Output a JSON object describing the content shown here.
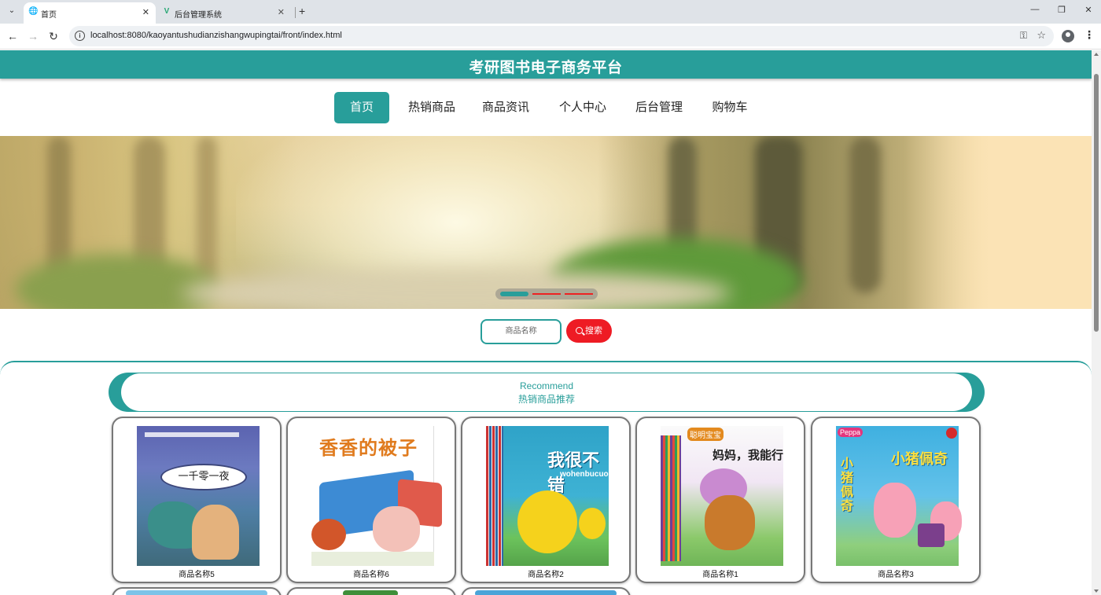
{
  "browser": {
    "tabs": [
      {
        "title": "首页",
        "active": true,
        "icon": "globe-icon"
      },
      {
        "title": "后台管理系统",
        "active": false,
        "icon": "vue-logo-icon"
      }
    ],
    "url": "localhost:8080/kaoyantushudianzishangwupingtai/front/index.html"
  },
  "site": {
    "title": "考研图书电子商务平台",
    "accent_color": "#289e9a"
  },
  "nav": {
    "items": [
      {
        "label": "首页",
        "active": true
      },
      {
        "label": "热销商品",
        "active": false
      },
      {
        "label": "商品资讯",
        "active": false
      },
      {
        "label": "个人中心",
        "active": false
      },
      {
        "label": "后台管理",
        "active": false
      },
      {
        "label": "购物车",
        "active": false
      }
    ]
  },
  "banner": {
    "slide_count": 3,
    "active_slide": 1
  },
  "search": {
    "placeholder": "商品名称",
    "button_label": "搜索",
    "button_color": "#ee1b24"
  },
  "recommend": {
    "title_en": "Recommend",
    "title_cn": "热销商品推荐",
    "products": [
      {
        "name": "商品名称5",
        "cover_title": "一千零一夜"
      },
      {
        "name": "商品名称6",
        "cover_title": "香香的被子"
      },
      {
        "name": "商品名称2",
        "cover_title": "我很不错",
        "cover_subtitle": "wohenbucuo"
      },
      {
        "name": "商品名称1",
        "cover_title": "妈妈，我能行",
        "cover_badge": "聪明宝宝"
      },
      {
        "name": "商品名称3",
        "cover_title": "小猪佩奇"
      }
    ]
  }
}
